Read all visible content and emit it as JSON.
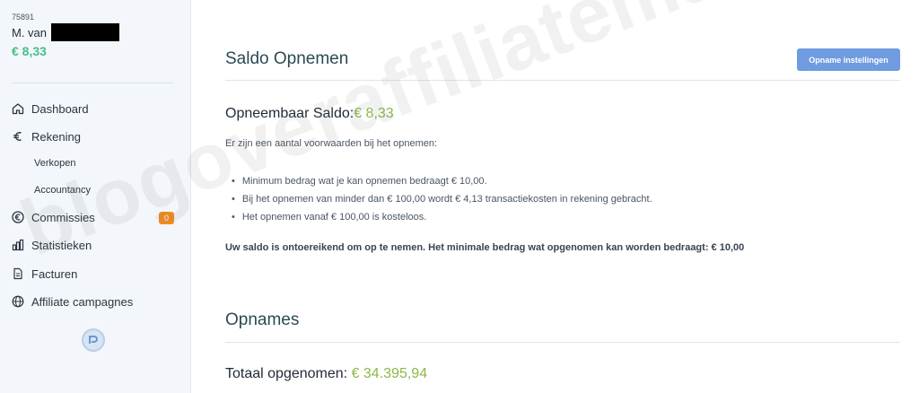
{
  "account": {
    "id": "75891",
    "name": "M. van",
    "balance": "€ 8,33"
  },
  "sidebar": {
    "items": [
      {
        "label": "Dashboard",
        "icon": "home-icon"
      },
      {
        "label": "Rekening",
        "icon": "euro-icon"
      },
      {
        "label": "Verkopen",
        "sub": true
      },
      {
        "label": "Accountancy",
        "sub": true
      },
      {
        "label": "Commissies",
        "icon": "euro-circle-icon",
        "badge": "0"
      },
      {
        "label": "Statistieken",
        "icon": "bar-chart-icon"
      },
      {
        "label": "Facturen",
        "icon": "document-icon"
      },
      {
        "label": "Affiliate campagnes",
        "icon": "globe-icon"
      }
    ]
  },
  "main": {
    "title": "Saldo Opnemen",
    "settings_button": "Opname instellingen",
    "saldo_label": "Opneembaar Saldo:",
    "saldo_value": "€ 8,33",
    "intro": "Er zijn een aantal voorwaarden bij het opnemen:",
    "conditions": [
      "Minimum bedrag wat je kan opnemen bedraagt € 10,00.",
      "Bij het opnemen van minder dan € 100,00 wordt € 4,13 transactiekosten in rekening gebracht.",
      "Het opnemen vanaf € 100,00 is kosteloos."
    ],
    "warning": "Uw saldo is ontoereikend om op te nemen. Het minimale bedrag wat opgenomen kan worden bedraagt: € 10,00",
    "withdrawals_title": "Opnames",
    "total_label": "Totaal opgenomen:",
    "total_value": "€ 34.395,94"
  },
  "watermark": "blogoveraffiliatemarketing.nl",
  "colors": {
    "accent_green": "#46c08a",
    "amount_green": "#8cb84a",
    "button_blue": "#6f9be0",
    "badge_orange": "#f08c1e"
  }
}
